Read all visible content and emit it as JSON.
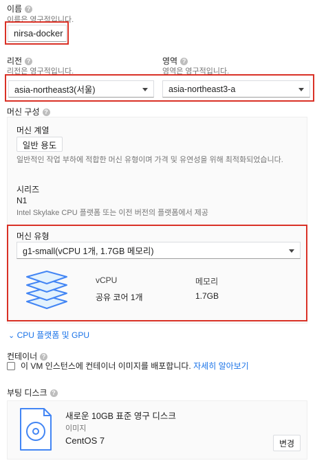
{
  "name": {
    "label": "이름",
    "help": "?",
    "note": "이름은 영구적입니다.",
    "value": "nirsa-docker"
  },
  "region": {
    "label": "리전",
    "help": "?",
    "note": "리전은 영구적입니다.",
    "value": "asia-northeast3(서울)"
  },
  "zone": {
    "label": "영역",
    "help": "?",
    "note": "영역은 영구적입니다.",
    "value": "asia-northeast3-a"
  },
  "machine_config": {
    "label": "머신 구성",
    "help": "?",
    "family_label": "머신 계열",
    "family_tab": "일반 용도",
    "family_desc": "일반적인 작업 부하에 적합한 머신 유형이며 가격 및 유연성을 위해 최적화되었습니다.",
    "series_label": "시리즈",
    "series_value": "N1",
    "series_desc": "Intel Skylake CPU 플랫폼 또는 이전 버전의 플랫폼에서 제공",
    "type_label": "머신 유형",
    "type_value": "g1-small(vCPU 1개, 1.7GB 메모리)",
    "vcpu_header": "vCPU",
    "memory_header": "메모리",
    "vcpu_value": "공유 코어 1개",
    "memory_value": "1.7GB"
  },
  "cpu_gpu_link": "CPU 플랫폼 및 GPU",
  "container": {
    "label": "컨테이너",
    "help": "?",
    "checkbox_text": "이 VM 인스턴스에 컨테이너 이미지를 배포합니다.",
    "learn_more": "자세히 알아보기",
    "checked": false
  },
  "boot_disk": {
    "label": "부팅 디스크",
    "help": "?",
    "title": "새로운 10GB 표준 영구 디스크",
    "image_label": "이미지",
    "image_value": "CentOS 7",
    "change_button": "변경"
  },
  "colors": {
    "accent": "#1a73e8",
    "highlight": "#d93025",
    "stack_icon": "#4285f4"
  }
}
